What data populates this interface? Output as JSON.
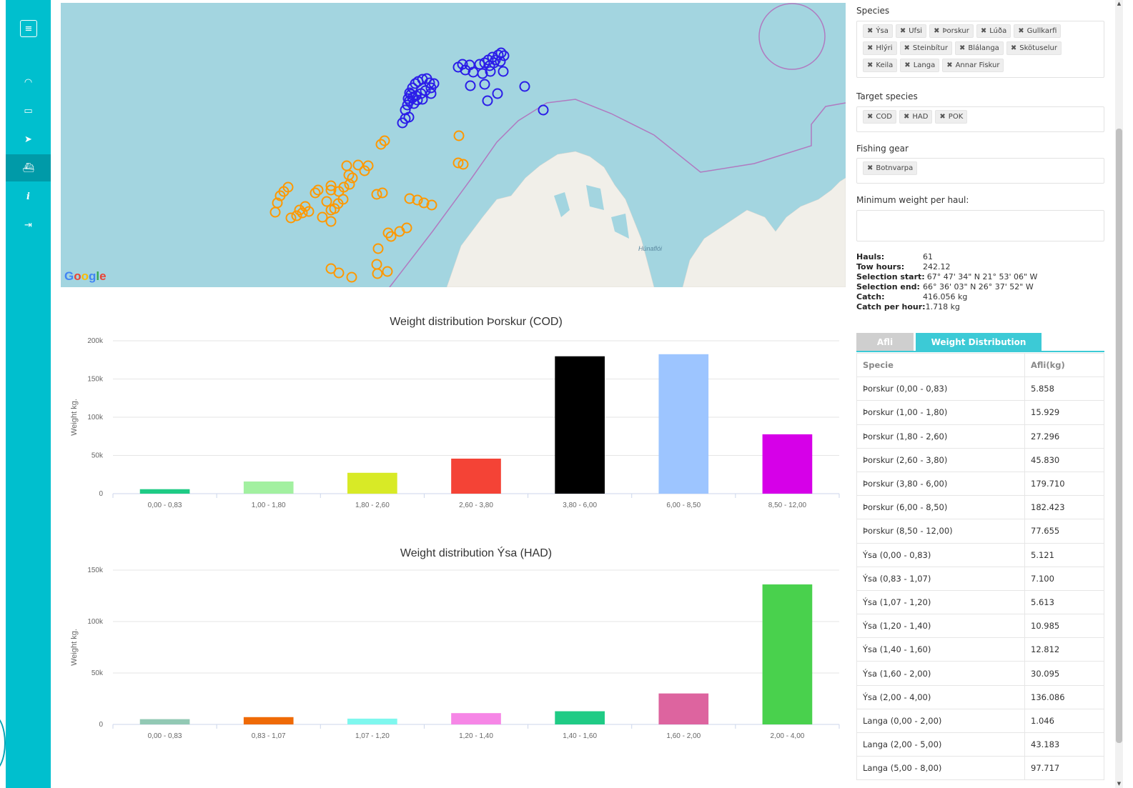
{
  "sidebar": {
    "items": [
      {
        "icon": "dashboard-icon",
        "glyph": "◠"
      },
      {
        "icon": "calendar-icon",
        "glyph": "▭"
      },
      {
        "icon": "send-icon",
        "glyph": "➤"
      },
      {
        "icon": "ship-icon",
        "glyph": "⛴"
      },
      {
        "icon": "info-icon",
        "glyph": "i"
      },
      {
        "icon": "logout-icon",
        "glyph": "⇥"
      }
    ],
    "menu_glyph": "≡"
  },
  "map": {
    "logo": "Google",
    "label": "Húnaflói"
  },
  "panel": {
    "species_label": "Species",
    "species": [
      "Ýsa",
      "Ufsi",
      "Þorskur",
      "Lúða",
      "Gullkarfi",
      "Hlýri",
      "Steinbítur",
      "Blálanga",
      "Skötuselur",
      "Keila",
      "Langa",
      "Annar Fiskur"
    ],
    "target_label": "Target species",
    "target": [
      "COD",
      "HAD",
      "POK"
    ],
    "gear_label": "Fishing gear",
    "gear": [
      "Botnvarpa"
    ],
    "min_weight_label": "Minimum weight per haul:",
    "stats": [
      {
        "k": "Hauls:",
        "v": "61"
      },
      {
        "k": "Tow hours:",
        "v": "242.12"
      },
      {
        "k": "Selection start:",
        "v": "67° 47' 34\" N 21° 53' 06\" W"
      },
      {
        "k": "Selection end:",
        "v": "66° 36' 03\" N 26° 37' 52\" W"
      },
      {
        "k": "Catch:",
        "v": "416.056 kg"
      },
      {
        "k": "Catch per hour:",
        "v": "1.718 kg"
      }
    ],
    "tabs": {
      "afli": "Afli",
      "weight": "Weight Distribution"
    },
    "table": {
      "headers": [
        "Specie",
        "Afli(kg)"
      ],
      "rows": [
        [
          "Þorskur (0,00 - 0,83)",
          "5.858"
        ],
        [
          "Þorskur (1,00 - 1,80)",
          "15.929"
        ],
        [
          "Þorskur (1,80 - 2,60)",
          "27.296"
        ],
        [
          "Þorskur (2,60 - 3,80)",
          "45.830"
        ],
        [
          "Þorskur (3,80 - 6,00)",
          "179.710"
        ],
        [
          "Þorskur (6,00 - 8,50)",
          "182.423"
        ],
        [
          "Þorskur (8,50 - 12,00)",
          "77.655"
        ],
        [
          "Ýsa (0,00 - 0,83)",
          "5.121"
        ],
        [
          "Ýsa (0,83 - 1,07)",
          "7.100"
        ],
        [
          "Ýsa (1,07 - 1,20)",
          "5.613"
        ],
        [
          "Ýsa (1,20 - 1,40)",
          "10.985"
        ],
        [
          "Ýsa (1,40 - 1,60)",
          "12.812"
        ],
        [
          "Ýsa (1,60 - 2,00)",
          "30.095"
        ],
        [
          "Ýsa (2,00 - 4,00)",
          "136.086"
        ],
        [
          "Langa (0,00 - 2,00)",
          "1.046"
        ],
        [
          "Langa (2,00 - 5,00)",
          "43.183"
        ],
        [
          "Langa (5,00 - 8,00)",
          "97.717"
        ]
      ]
    }
  },
  "chart_data": [
    {
      "type": "bar",
      "title": "Weight distribution Þorskur (COD)",
      "ylabel": "Weight kg.",
      "xlabel": "",
      "ylim": [
        0,
        200000
      ],
      "yticks": [
        0,
        50000,
        100000,
        150000,
        200000
      ],
      "ytick_labels": [
        "0",
        "50k",
        "100k",
        "150k",
        "200k"
      ],
      "categories": [
        "0,00 - 0,83",
        "1,00 - 1,80",
        "1,80 - 2,60",
        "2,60 - 3,80",
        "3,80 - 6,00",
        "6,00 - 8,50",
        "8,50 - 12,00"
      ],
      "values": [
        5858,
        15929,
        27296,
        45830,
        179710,
        182423,
        77655
      ],
      "colors": [
        "#1fcb85",
        "#a2f0a0",
        "#d8ea26",
        "#f44336",
        "#000000",
        "#9dc5ff",
        "#d600e8"
      ],
      "grid": true,
      "legend": "none"
    },
    {
      "type": "bar",
      "title": "Weight distribution Ýsa (HAD)",
      "ylabel": "Weight kg.",
      "xlabel": "",
      "ylim": [
        0,
        150000
      ],
      "yticks": [
        0,
        50000,
        100000,
        150000
      ],
      "ytick_labels": [
        "0",
        "50k",
        "100k",
        "150k"
      ],
      "categories": [
        "0,00 - 0,83",
        "0,83 - 1,07",
        "1,07 - 1,20",
        "1,20 - 1,40",
        "1,40 - 1,60",
        "1,60 - 2,00",
        "2,00 - 4,00"
      ],
      "values": [
        5121,
        7100,
        5613,
        10985,
        12812,
        30095,
        136086
      ],
      "colors": [
        "#92c9b4",
        "#ef6a06",
        "#7ff7ee",
        "#f686e6",
        "#1fcb85",
        "#dd649f",
        "#49d14d"
      ],
      "grid": true,
      "legend": "none"
    }
  ],
  "colors": {
    "accent": "#00bfce",
    "tab_active": "#3ccad6",
    "map_water": "#a3d5e0",
    "orange_marker": "#ff9800",
    "blue_marker": "#2b1de8",
    "boundary": "#b07ac0"
  }
}
